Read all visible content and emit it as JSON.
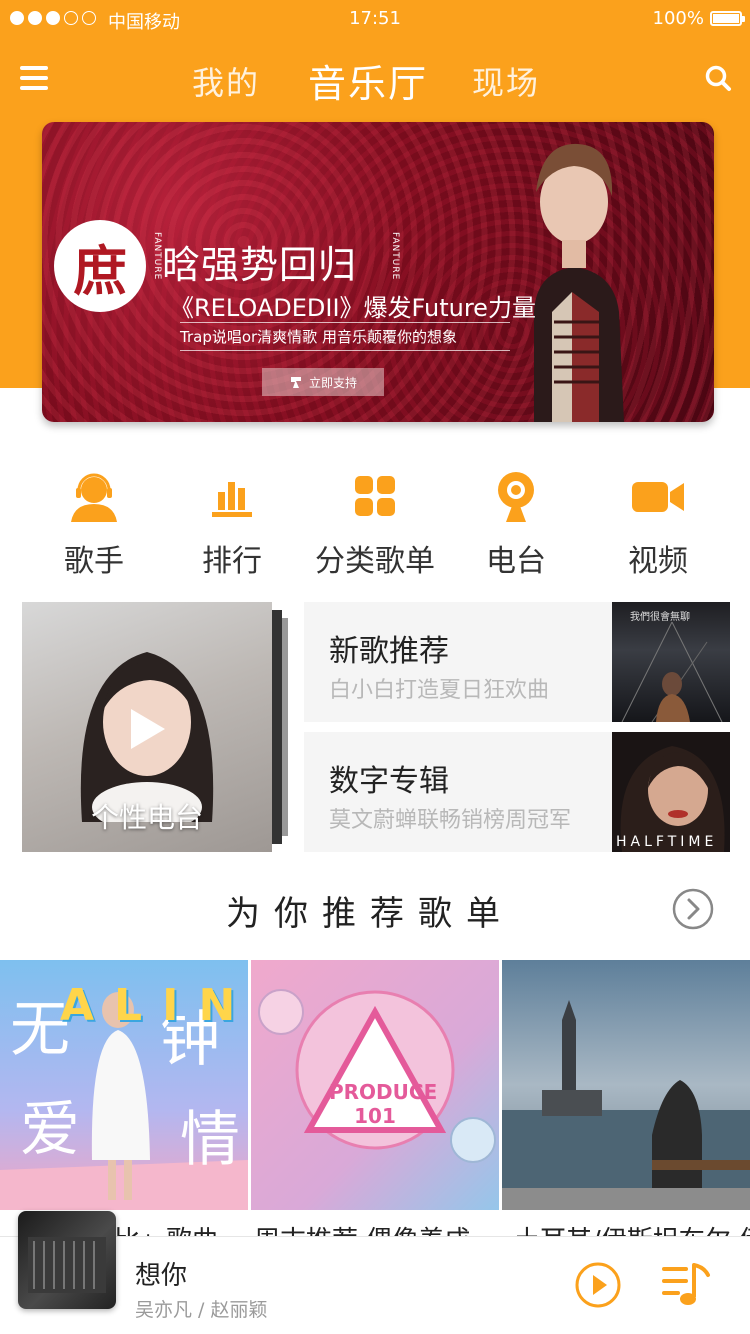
{
  "colors": {
    "accent": "#fba11c",
    "text_primary": "#222222",
    "text_secondary": "#b8b8b8"
  },
  "status_bar": {
    "carrier": "中国移动",
    "time": "17:51",
    "battery": "100%",
    "signal_dots_filled": 3,
    "signal_dots_total": 5
  },
  "nav": {
    "tabs": [
      {
        "label": "我的",
        "active": false
      },
      {
        "label": "音乐厅",
        "active": true
      },
      {
        "label": "现场",
        "active": false
      }
    ],
    "menu_icon": "hamburger-icon",
    "search_icon": "search-icon"
  },
  "banner": {
    "logo_char": "庶",
    "side_text": "FANTURE",
    "headline": "晗强势回归",
    "subtitle": "《RELOADEDII》爆发Future力量",
    "tagline": "Trap说唱or清爽情歌  用音乐颠覆你的想象",
    "button": "立即支持"
  },
  "categories": [
    {
      "label": "歌手",
      "icon": "singer-icon"
    },
    {
      "label": "排行",
      "icon": "chart-icon"
    },
    {
      "label": "分类歌单",
      "icon": "grid-icon"
    },
    {
      "label": "电台",
      "icon": "radio-icon"
    },
    {
      "label": "视频",
      "icon": "video-icon"
    }
  ],
  "radio_card": {
    "label": "个性电台"
  },
  "features": [
    {
      "title": "新歌推荐",
      "desc": "白小白打造夏日狂欢曲",
      "cover_text": "我們很會無聊"
    },
    {
      "title": "数字专辑",
      "desc": "莫文蔚蝉联畅销榜周冠军",
      "cover_text": "HALFTIME"
    }
  ],
  "section": {
    "title": "为你推荐歌单"
  },
  "playlists": [
    {
      "caption": "「无与伦比」歌曲",
      "cover_text": "ALIN"
    },
    {
      "caption": "周末推荐  偶像养成",
      "cover_text": "PRODUCE 101"
    },
    {
      "caption": "土耳其/伊斯坦布尔  伊斯",
      "cover_text": ""
    }
  ],
  "player": {
    "song": "想你",
    "artist": "吴亦凡 / 赵丽颖"
  }
}
